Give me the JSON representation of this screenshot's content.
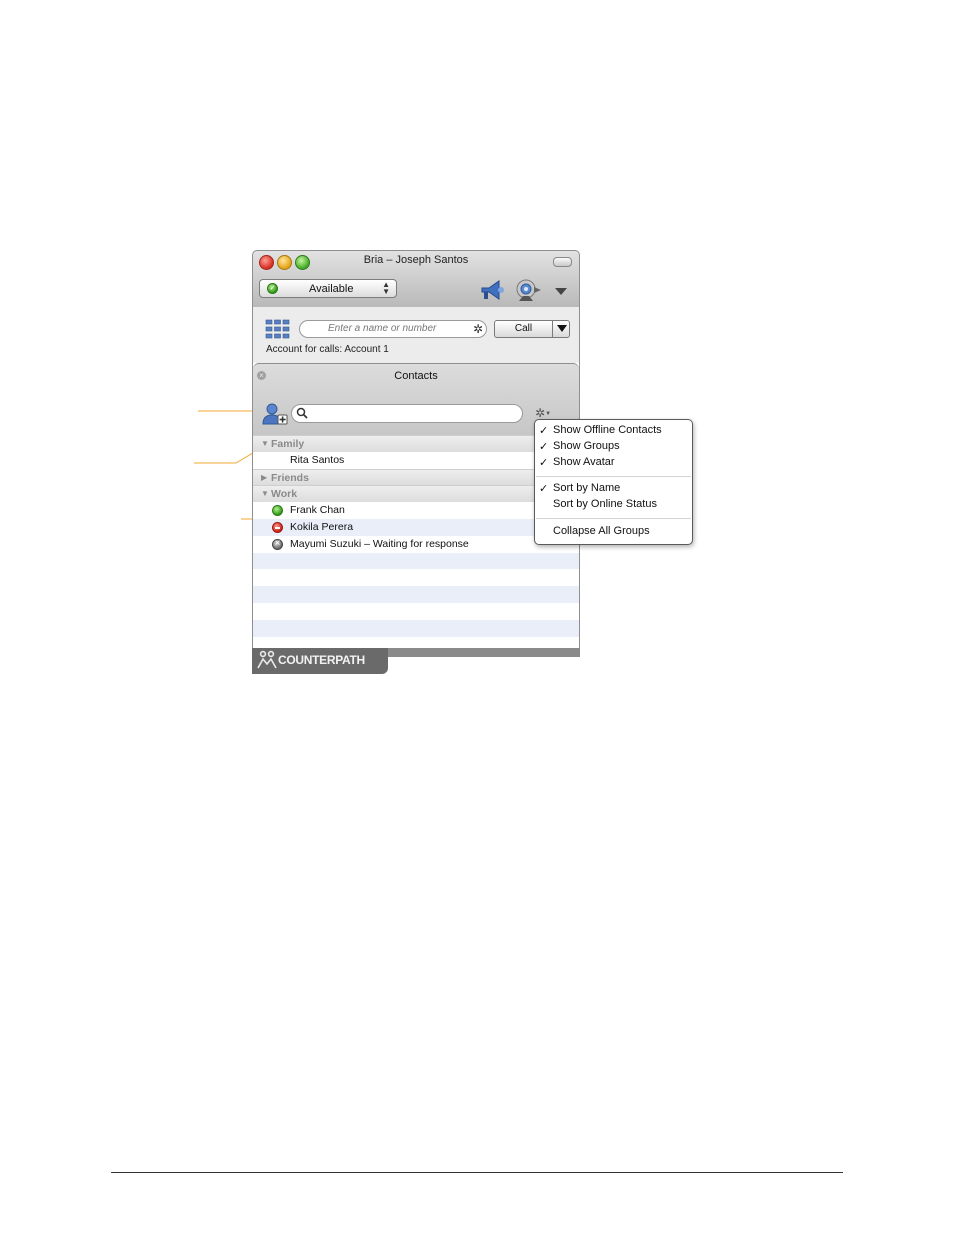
{
  "window": {
    "title": "Bria – Joseph Santos",
    "status": "Available"
  },
  "callbar": {
    "placeholder": "Enter a name or number",
    "call_label": "Call",
    "account_label": "Account for calls: Account 1"
  },
  "contacts": {
    "title": "Contacts",
    "search_value": "",
    "groups": [
      {
        "name": "Family",
        "expanded": true,
        "contacts": [
          {
            "name": "Rita Santos",
            "presence": "none"
          }
        ]
      },
      {
        "name": "Friends",
        "expanded": false,
        "contacts": []
      },
      {
        "name": "Work",
        "expanded": true,
        "contacts": [
          {
            "name": "Frank Chan",
            "presence": "online"
          },
          {
            "name": "Kokila Perera",
            "presence": "busy"
          },
          {
            "name": "Mayumi Suzuki – Waiting for response",
            "presence": "pending"
          }
        ]
      }
    ]
  },
  "footer": {
    "brand": "COUNTERPATH"
  },
  "menu": {
    "items": [
      {
        "label": "Show Offline Contacts",
        "checked": true
      },
      {
        "label": "Show Groups",
        "checked": true
      },
      {
        "label": "Show Avatar",
        "checked": true
      },
      {
        "label": "Sort by Name",
        "checked": true
      },
      {
        "label": "Sort by Online Status",
        "checked": false
      },
      {
        "label": "Collapse All Groups",
        "checked": false
      }
    ],
    "check_glyph": "✓"
  },
  "colors": {
    "callout": "#f0a830",
    "row_alt": "#e9eef9"
  },
  "icons": {
    "status": "green-check-icon",
    "phone": "megaphone-icon",
    "webcam": "webcam-icon",
    "toolbar_menu": "triangle-down-icon",
    "dialpad": "dialpad-icon",
    "call_settings": "gear-icon",
    "add_contact": "add-contact-icon",
    "search": "magnifier-icon",
    "contacts_menu": "gear-icon",
    "brand": "counterpath-logo"
  }
}
